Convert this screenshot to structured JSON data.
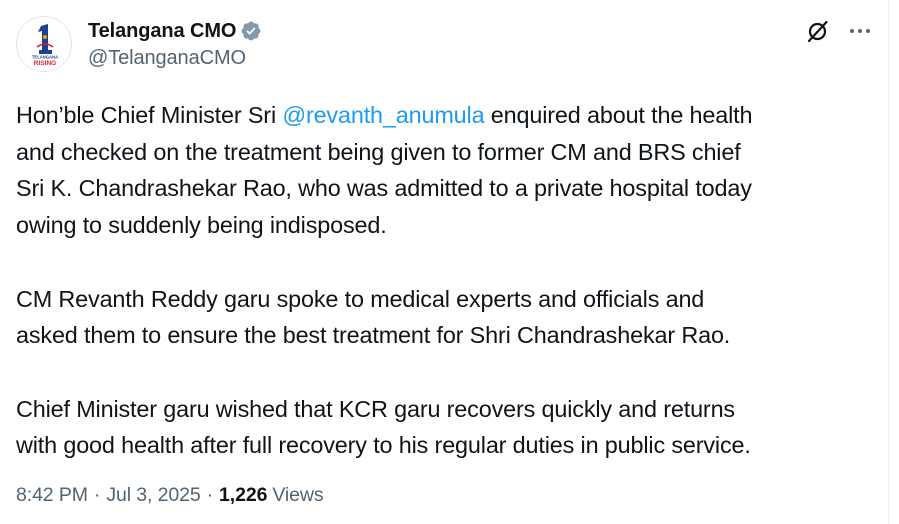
{
  "author": {
    "display_name": "Telangana CMO",
    "handle": "@TelanganaCMO",
    "avatar_logo_text": [
      "TELANGANA",
      "RISING"
    ],
    "verified_icon": "verified-badge-icon"
  },
  "actions": {
    "grok_icon": "grok-icon",
    "more_icon": "more-options-icon"
  },
  "tweet": {
    "p1_prefix": "Hon’ble Chief Minister Sri ",
    "p1_mention": "@revanth_anumula",
    "p1_line1_suffix": " enquired about the health",
    "p1_line2": "and checked on the treatment being given to former CM and BRS chief",
    "p1_line3": "Sri K. Chandrashekar Rao, who was admitted to a private hospital today",
    "p1_line4": "owing to suddenly being indisposed.",
    "p2_line1": "CM Revanth Reddy garu spoke to medical experts and officials and",
    "p2_line2": "asked them to ensure the best treatment for Shri Chandrashekar Rao.",
    "p3_line1": "Chief Minister garu wished that KCR garu recovers quickly and returns",
    "p3_line2": "with good health after full recovery to his regular duties in public service."
  },
  "meta": {
    "time": "8:42 PM",
    "separator": "·",
    "date": "Jul 3, 2025",
    "views_count": "1,226",
    "views_label": "Views"
  },
  "colors": {
    "text": "#0f1419",
    "secondary": "#536471",
    "link": "#1d9bf0",
    "verified": "#829aab"
  }
}
